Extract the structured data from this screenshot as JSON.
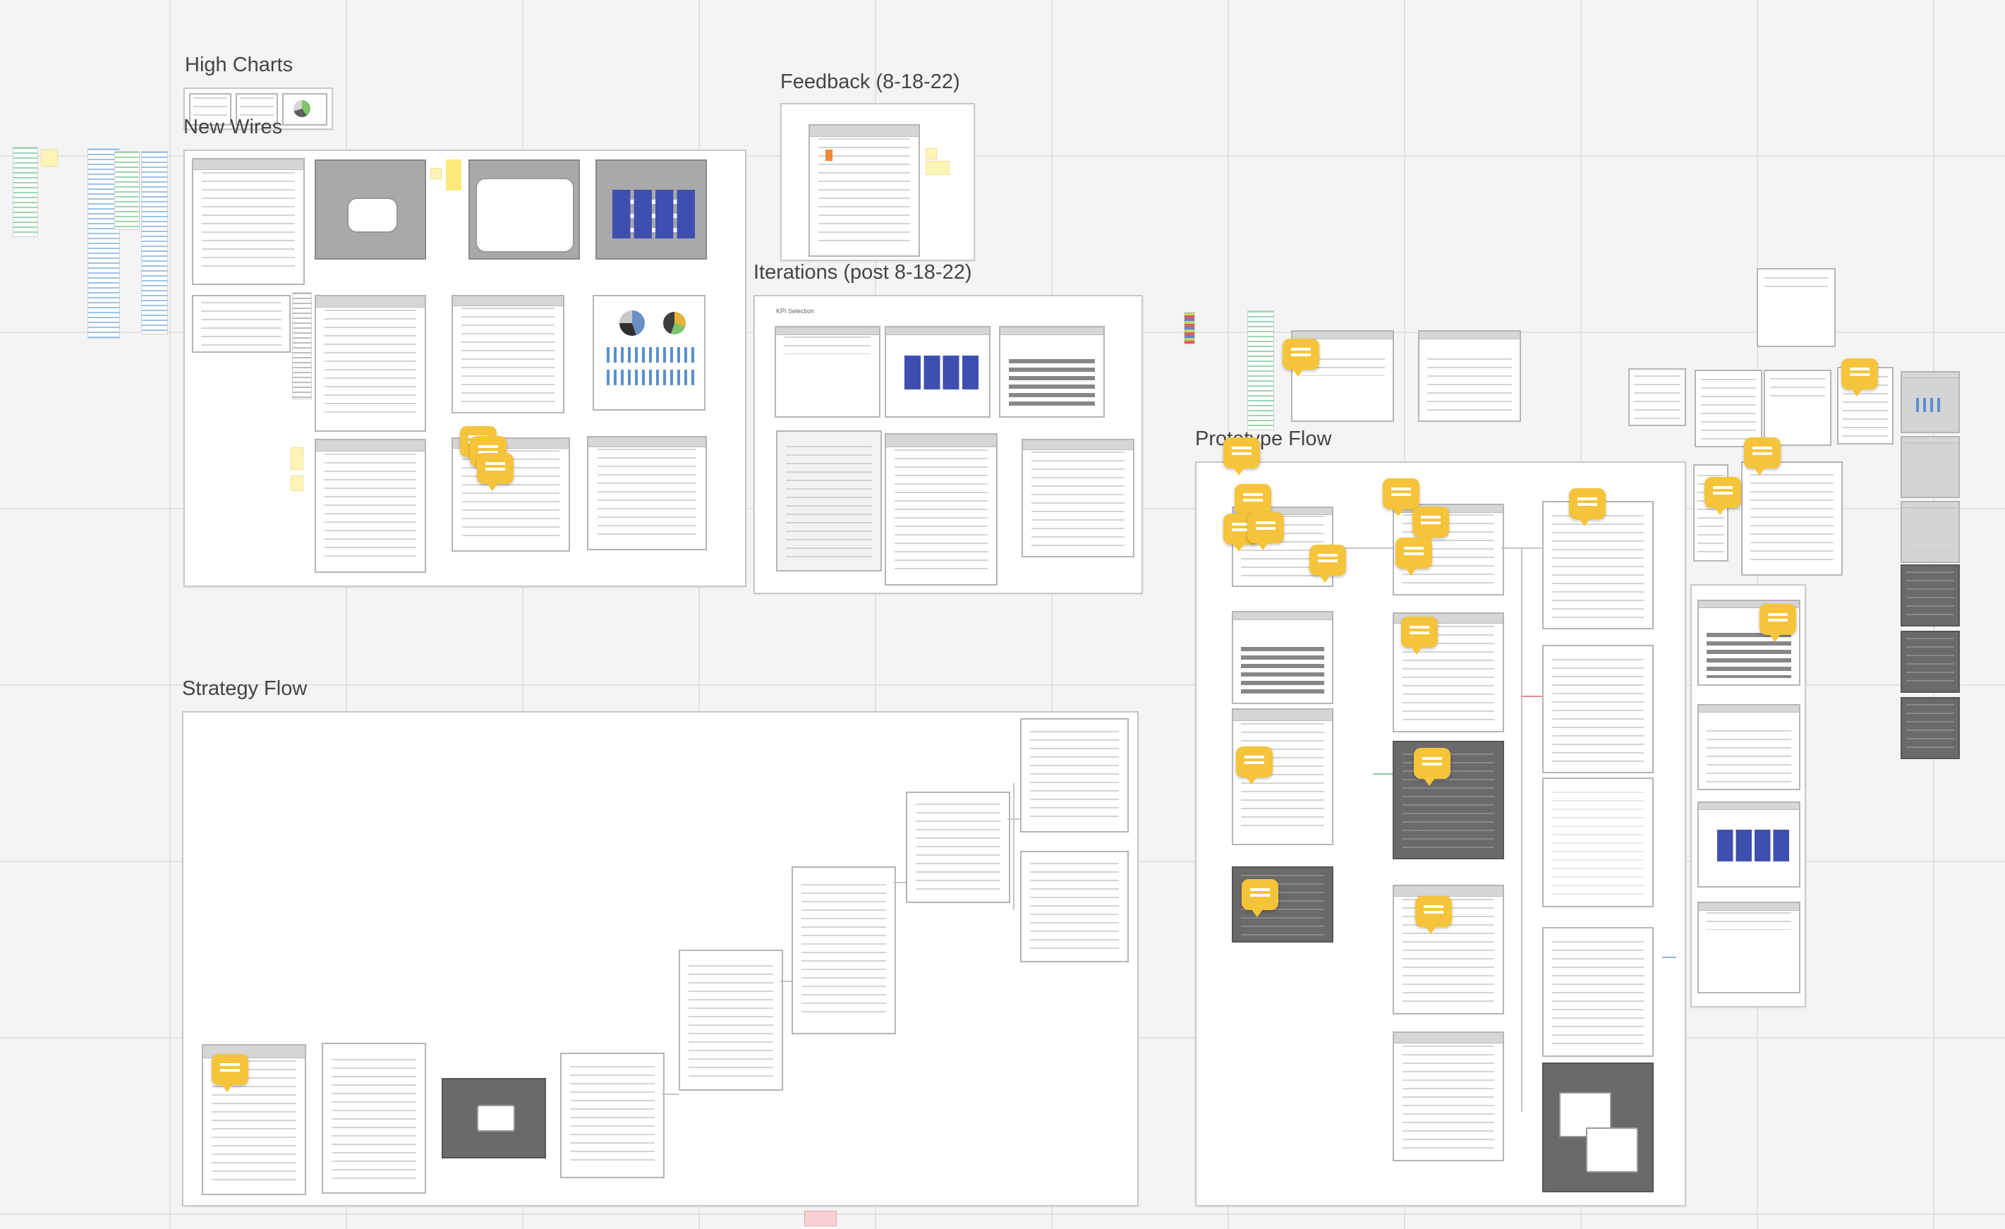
{
  "board": {
    "frames": {
      "high_charts": "High Charts",
      "new_wires": "New Wires",
      "feedback": "Feedback (8-18-22)",
      "iterations": "Iterations (post 8-18-22)",
      "prototype_flow": "Prototype Flow",
      "strategy_flow": "Strategy Flow"
    },
    "iterations_subtitle": "KPI Selection"
  },
  "colors": {
    "canvas": "#f4f4f4",
    "comment": "#f5c43b",
    "sticky": "#fbe97a",
    "wire_blue": "#3f4fb0"
  },
  "icons": [
    "comment-icon",
    "pie-chart-icon",
    "bar-chart-icon"
  ]
}
